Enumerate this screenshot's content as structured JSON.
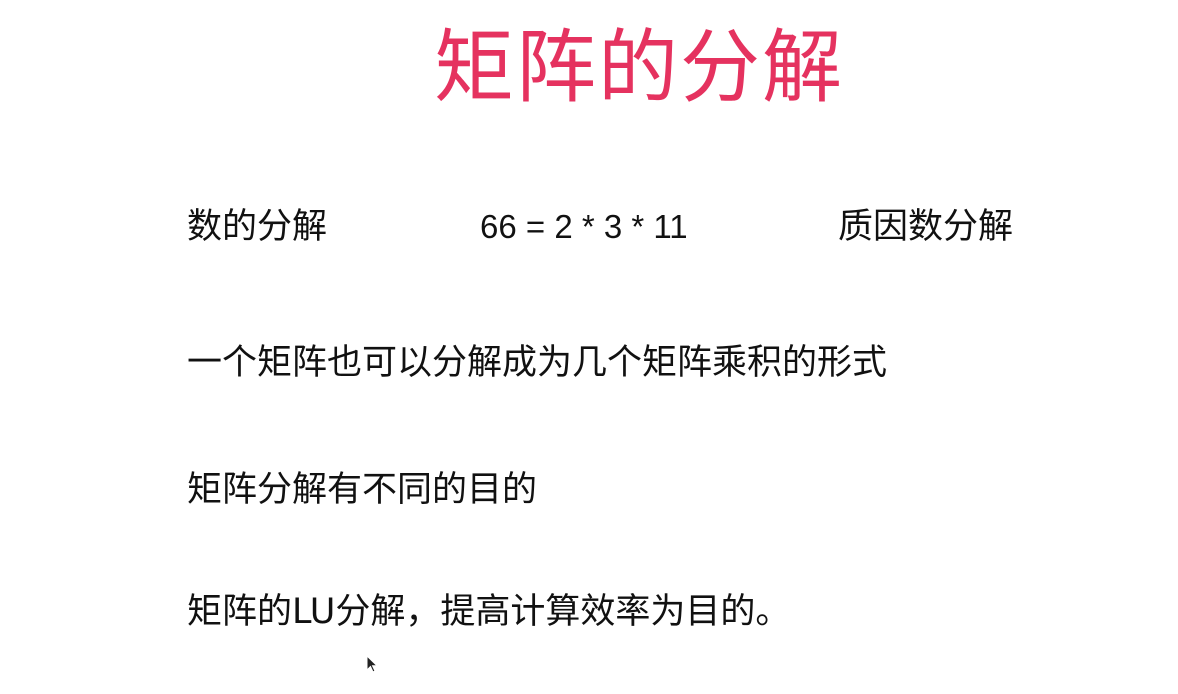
{
  "slide": {
    "title": "矩阵的分解",
    "row1": {
      "label": "数的分解",
      "example": "66 = 2 * 3 * 11",
      "note": "质因数分解"
    },
    "line2": "一个矩阵也可以分解成为几个矩阵乘积的形式",
    "line3": "矩阵分解有不同的目的",
    "line4": "矩阵的LU分解，提高计算效率为目的。"
  },
  "colors": {
    "title": "#e5325f",
    "text": "#111111",
    "background": "#ffffff"
  },
  "icons": {
    "cursor": "mouse-pointer-icon"
  }
}
